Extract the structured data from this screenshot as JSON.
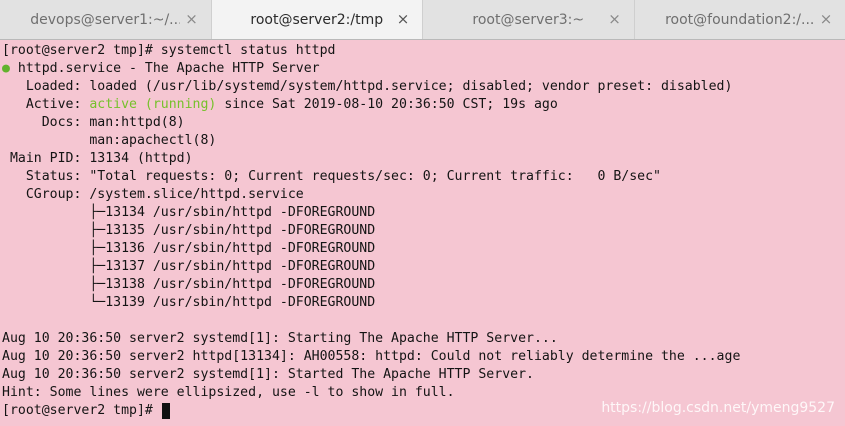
{
  "tabs": [
    {
      "label": "devops@server1:~/...",
      "close": "×",
      "active": false
    },
    {
      "label": "root@server2:/tmp",
      "close": "×",
      "active": true
    },
    {
      "label": "root@server3:~",
      "close": "×",
      "active": false
    },
    {
      "label": "root@foundation2:/...",
      "close": "×",
      "active": false
    }
  ],
  "terminal": {
    "lines": [
      "[root@server2 tmp]# systemctl status httpd",
      {
        "dot": "●",
        "text": " httpd.service - The Apache HTTP Server"
      },
      "   Loaded: loaded (/usr/lib/systemd/system/httpd.service; disabled; vendor preset: disabled)",
      {
        "pre": "   Active: ",
        "status": "active (running)",
        "post": " since Sat 2019-08-10 20:36:50 CST; 19s ago"
      },
      "     Docs: man:httpd(8)",
      "           man:apachectl(8)",
      " Main PID: 13134 (httpd)",
      "   Status: \"Total requests: 0; Current requests/sec: 0; Current traffic:   0 B/sec\"",
      "   CGroup: /system.slice/httpd.service",
      "           ├─13134 /usr/sbin/httpd -DFOREGROUND",
      "           ├─13135 /usr/sbin/httpd -DFOREGROUND",
      "           ├─13136 /usr/sbin/httpd -DFOREGROUND",
      "           ├─13137 /usr/sbin/httpd -DFOREGROUND",
      "           ├─13138 /usr/sbin/httpd -DFOREGROUND",
      "           └─13139 /usr/sbin/httpd -DFOREGROUND",
      "",
      "Aug 10 20:36:50 server2 systemd[1]: Starting The Apache HTTP Server...",
      "Aug 10 20:36:50 server2 httpd[13134]: AH00558: httpd: Could not reliably determine the ...age",
      "Aug 10 20:36:50 server2 systemd[1]: Started The Apache HTTP Server.",
      "Hint: Some lines were ellipsized, use -l to show in full."
    ],
    "prompt": "[root@server2 tmp]# "
  },
  "watermark": "https://blog.csdn.net/ymeng9527",
  "colors": {
    "background": "#f5c6d2",
    "active_green": "#76c12c",
    "text": "#141414"
  }
}
